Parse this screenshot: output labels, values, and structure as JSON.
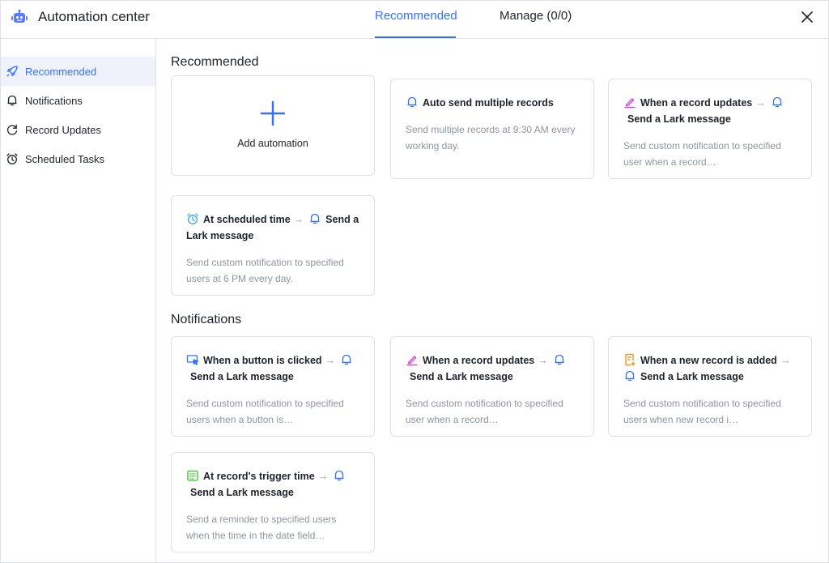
{
  "header": {
    "title": "Automation center",
    "tabs": [
      {
        "label": "Recommended"
      },
      {
        "label": "Manage (0/0)"
      }
    ]
  },
  "sidebar": {
    "items": [
      {
        "label": "Recommended",
        "icon": "rocket-icon"
      },
      {
        "label": "Notifications",
        "icon": "bell-icon"
      },
      {
        "label": "Record Updates",
        "icon": "refresh-icon"
      },
      {
        "label": "Scheduled Tasks",
        "icon": "alarm-clock-icon"
      }
    ]
  },
  "sections": {
    "recommended": {
      "title": "Recommended",
      "add_label": "Add automation",
      "cards": [
        {
          "trigger": "Auto send multiple records",
          "desc": "Send multiple records at 9:30 AM every working day."
        },
        {
          "trigger": "When a record updates",
          "action": "Send a Lark message",
          "desc": "Send custom notification to specified user when a record…"
        },
        {
          "trigger": "At scheduled time",
          "action": "Send a Lark message",
          "desc": "Send custom notification to specified users at 6 PM every day."
        }
      ]
    },
    "notifications": {
      "title": "Notifications",
      "cards": [
        {
          "trigger": "When a button is clicked",
          "action": "Send a Lark message",
          "desc": "Send custom notification to specified users when a button is…"
        },
        {
          "trigger": "When a record updates",
          "action": "Send a Lark message",
          "desc": "Send custom notification to specified user when a record…"
        },
        {
          "trigger": "When a new record is added",
          "action": "Send a Lark message",
          "desc": "Send custom notification to specified users when new record i…"
        },
        {
          "trigger": "At record's trigger time",
          "action": "Send a Lark message",
          "desc": "Send a reminder to specified users when the time in the date field…"
        }
      ]
    }
  },
  "arrow": "→",
  "colors": {
    "accent": "#3370ff",
    "pink": "#d136d1",
    "orange": "#ff8800",
    "teal": "#3aa5e0",
    "green": "#34c724",
    "muted": "#8f959e"
  }
}
